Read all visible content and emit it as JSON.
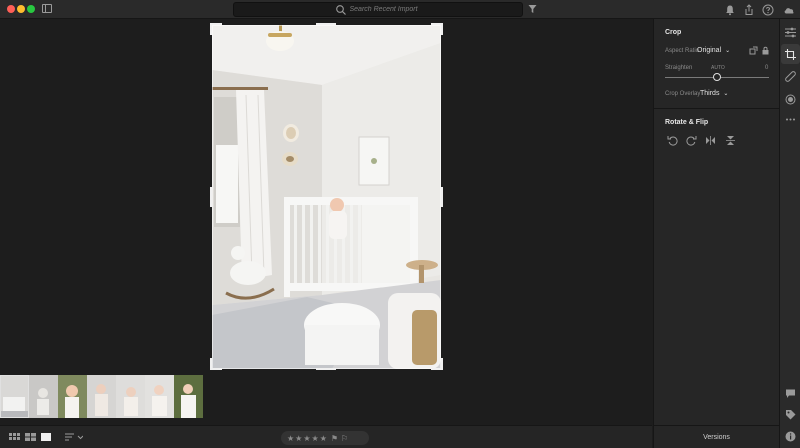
{
  "search": {
    "placeholder": "Search Recent Import"
  },
  "panel": {
    "crop_title": "Crop",
    "aspect_ratio_label": "Aspect Ratio",
    "aspect_ratio_value": "Original",
    "straighten_label": "Straighten",
    "straighten_auto": "AUTO",
    "straighten_value": "0",
    "crop_overlay_label": "Crop Overlay",
    "crop_overlay_value": "Thirds",
    "rotate_title": "Rotate & Flip"
  },
  "bottombar": {
    "stars": "★★★★★"
  },
  "versions_label": "Versions",
  "icons": {
    "search": "search-icon",
    "filter": "filter-icon",
    "bell": "bell-icon",
    "share": "share-icon",
    "help": "help-icon",
    "cloud": "cloud-icon",
    "edit_sliders": "sliders-icon",
    "crop": "crop-icon",
    "heal": "bandage-icon",
    "mask": "mask-icon",
    "more": "more-icon",
    "comment": "comment-icon",
    "tag": "tag-icon",
    "info": "info-icon"
  },
  "colors": {
    "background": "#1d1d1d",
    "panel": "#262626",
    "accent_text": "#e6e6e6"
  }
}
